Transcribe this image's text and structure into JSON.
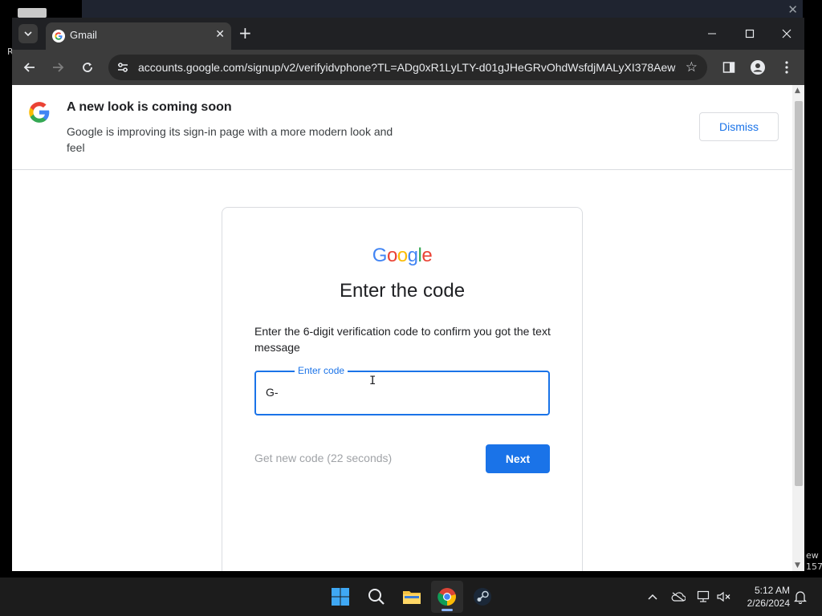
{
  "browser": {
    "tab_title": "Gmail",
    "url": "accounts.google.com/signup/v2/verifyidvphone?TL=ADg0xR1LyLTY-d01gJHeGRvOhdWsfdjMALyXI378Aew..."
  },
  "banner": {
    "headline": "A new look is coming soon",
    "body": "Google is improving its sign-in page with a more modern look and feel",
    "dismiss_label": "Dismiss"
  },
  "card": {
    "wordmark_letters": [
      "G",
      "o",
      "o",
      "g",
      "l",
      "e"
    ],
    "wordmark_colors": [
      "#4285F4",
      "#EA4335",
      "#FBBC05",
      "#4285F4",
      "#34A853",
      "#EA4335"
    ],
    "heading": "Enter the code",
    "description": "Enter the 6-digit verification code to confirm you got the text message",
    "code_label": "Enter code",
    "code_value": "G-",
    "resend_label": "Get new code (22 seconds)",
    "next_label": "Next"
  },
  "desktop": {
    "fragment_r": "R",
    "fragment_w": "ew",
    "fragment_num": "157"
  },
  "taskbar": {
    "time": "5:12 AM",
    "date": "2/26/2024"
  },
  "colors": {
    "accent": "#1a73e8",
    "chrome_dark": "#202124",
    "toolbar": "#3c3c3c"
  }
}
